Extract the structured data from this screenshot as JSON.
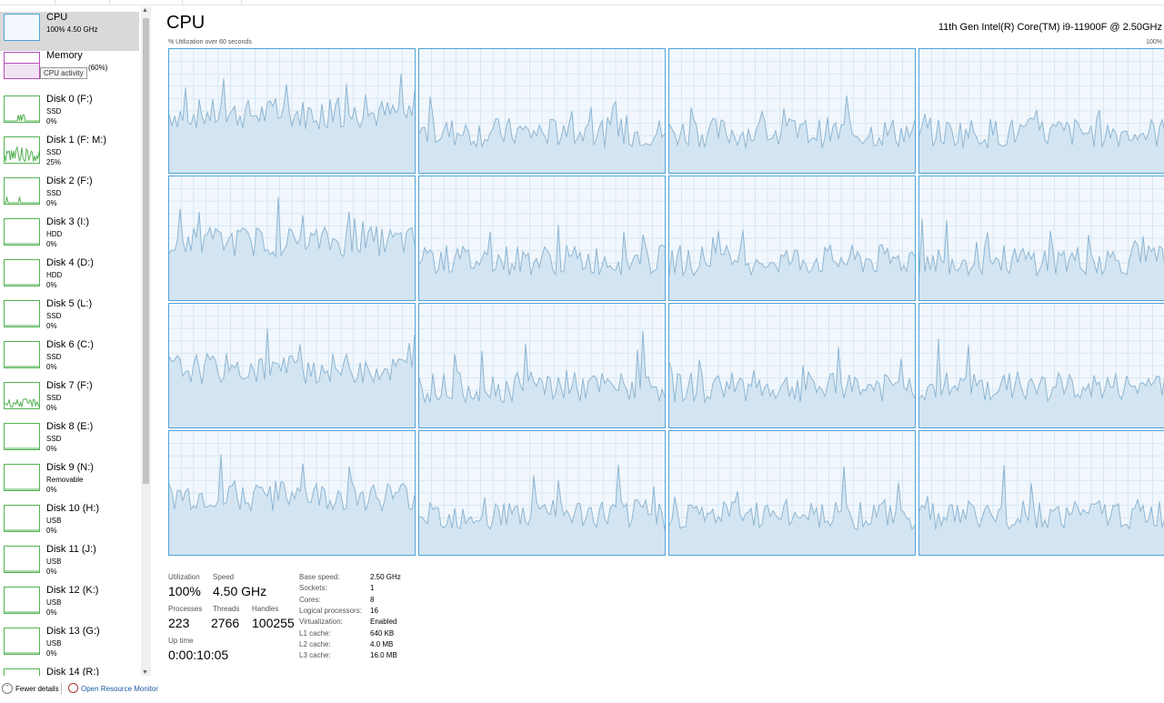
{
  "window": {
    "title": "CPU",
    "cpu_model": "11th Gen Intel(R) Core(TM) i9-11900F @ 2.50GHz"
  },
  "graph": {
    "util_label": "% Utilization over 60 seconds",
    "max_label": "100%"
  },
  "sidebar": {
    "tooltip": "CPU activity",
    "items": [
      {
        "name": "CPU",
        "sub1": "100% 4.50 GHz",
        "sub2": ""
      },
      {
        "name": "Memory",
        "sub1": "(60%)",
        "sub2": ""
      },
      {
        "name": "Disk 0 (F:)",
        "sub1": "SSD",
        "sub2": "0%"
      },
      {
        "name": "Disk 1 (F: M:)",
        "sub1": "SSD",
        "sub2": "25%"
      },
      {
        "name": "Disk 2 (F:)",
        "sub1": "SSD",
        "sub2": "0%"
      },
      {
        "name": "Disk 3 (I:)",
        "sub1": "HDD",
        "sub2": "0%"
      },
      {
        "name": "Disk 4 (D:)",
        "sub1": "HDD",
        "sub2": "0%"
      },
      {
        "name": "Disk 5 (L:)",
        "sub1": "SSD",
        "sub2": "0%"
      },
      {
        "name": "Disk 6 (C:)",
        "sub1": "SSD",
        "sub2": "0%"
      },
      {
        "name": "Disk 7 (F:)",
        "sub1": "SSD",
        "sub2": "0%"
      },
      {
        "name": "Disk 8 (E:)",
        "sub1": "SSD",
        "sub2": "0%"
      },
      {
        "name": "Disk 9 (N:)",
        "sub1": "Removable",
        "sub2": "0%"
      },
      {
        "name": "Disk 10 (H:)",
        "sub1": "USB",
        "sub2": "0%"
      },
      {
        "name": "Disk 11 (J:)",
        "sub1": "USB",
        "sub2": "0%"
      },
      {
        "name": "Disk 12 (K:)",
        "sub1": "USB",
        "sub2": "0%"
      },
      {
        "name": "Disk 13 (G:)",
        "sub1": "USB",
        "sub2": "0%"
      },
      {
        "name": "Disk 14 (R:)",
        "sub1": "",
        "sub2": ""
      }
    ]
  },
  "stats": {
    "utilization_label": "Utilization",
    "utilization": "100%",
    "speed_label": "Speed",
    "speed": "4.50 GHz",
    "processes_label": "Processes",
    "processes": "223",
    "threads_label": "Threads",
    "threads": "2766",
    "handles_label": "Handles",
    "handles": "100255",
    "uptime_label": "Up time",
    "uptime": "0:00:10:05"
  },
  "specs": [
    {
      "label": "Base speed:",
      "value": "2.50 GHz"
    },
    {
      "label": "Sockets:",
      "value": "1"
    },
    {
      "label": "Cores:",
      "value": "8"
    },
    {
      "label": "Logical processors:",
      "value": "16"
    },
    {
      "label": "Virtualization:",
      "value": "Enabled"
    },
    {
      "label": "L1 cache:",
      "value": "640 KB"
    },
    {
      "label": "L2 cache:",
      "value": "4.0 MB"
    },
    {
      "label": "L3 cache:",
      "value": "16.0 MB"
    }
  ],
  "footer": {
    "fewer_details": "Fewer details",
    "open_monitor": "Open Resource Monitor"
  },
  "colors": {
    "cpu_line": "#4fa3d8",
    "cpu_fill": "#d3e5f2",
    "disk": "#54b354",
    "memory": "#b84fb8",
    "link": "#1f5aa6"
  },
  "icons": {
    "fewer": "chevron-up-icon",
    "monitor": "resource-monitor-icon"
  }
}
